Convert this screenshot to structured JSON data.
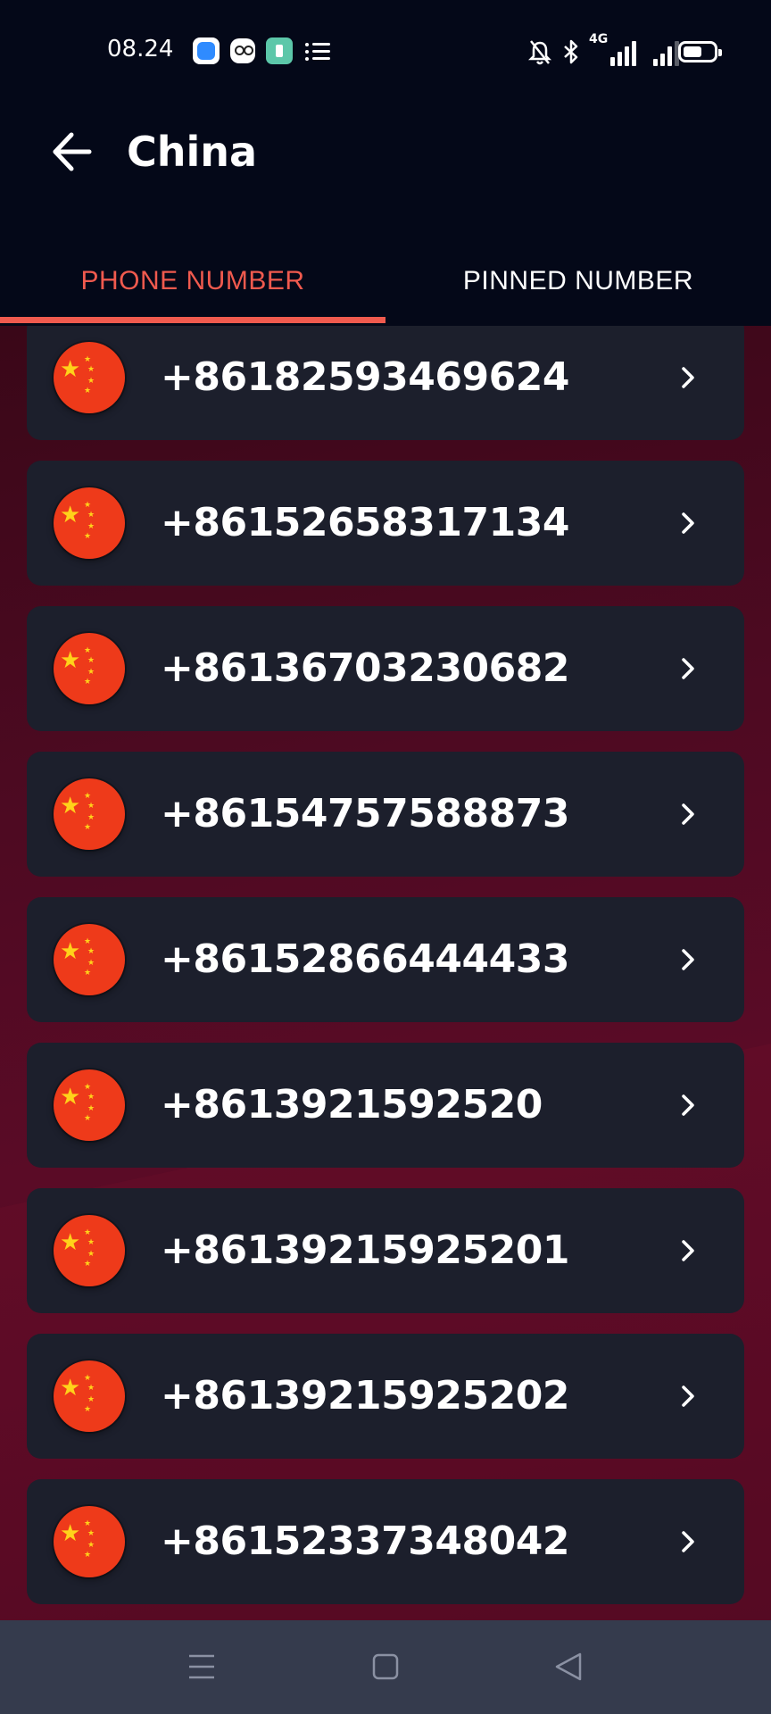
{
  "status_bar": {
    "time": "08.24",
    "network": "4G",
    "icons": [
      "app-blue-icon",
      "app-owl-icon",
      "app-green-icon",
      "list-notification-icon",
      "bell-off-icon",
      "bluetooth-icon",
      "signal-icon",
      "battery-icon"
    ]
  },
  "header": {
    "title": "China",
    "back_icon": "arrow-left-icon"
  },
  "tabs": {
    "phone_number": "PHONE NUMBER",
    "pinned_number": "PINNED NUMBER",
    "active": "phone_number"
  },
  "numbers": [
    "+86182593469624",
    "+86152658317134",
    "+86136703230682",
    "+86154757588873",
    "+86152866444433",
    "+8613921592520",
    "+86139215925201",
    "+86139215925202",
    "+86152337348042"
  ],
  "row_icons": {
    "flag": "china-flag-icon",
    "chevron": "chevron-right-icon"
  },
  "nav_bar": {
    "buttons": [
      "menu-icon",
      "home-icon",
      "back-triangle-icon"
    ]
  },
  "colors": {
    "accent": "#f05a4e",
    "header_bg": "#040818",
    "card_bg": "#1c1f2c",
    "content_bg": "#4e0a22",
    "nav_bg": "#353b4d"
  }
}
